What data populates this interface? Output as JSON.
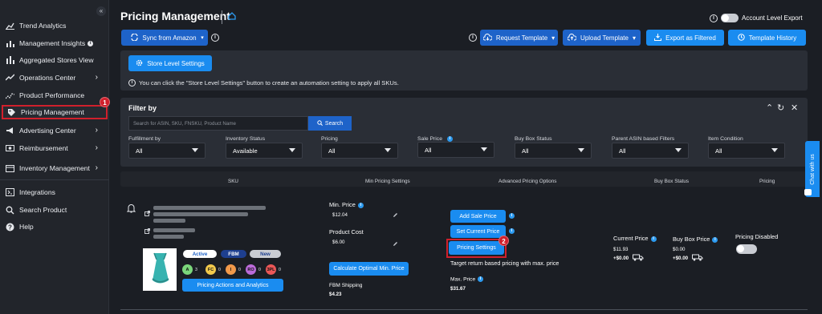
{
  "sidebar": {
    "items": [
      {
        "label": "Trend Analytics"
      },
      {
        "label": "Management Insights"
      },
      {
        "label": "Aggregated Stores View"
      },
      {
        "label": "Operations Center"
      },
      {
        "label": "Product Performance"
      },
      {
        "label": "Pricing Management"
      },
      {
        "label": "Advertising Center"
      },
      {
        "label": "Reimbursement"
      },
      {
        "label": "Inventory Management"
      },
      {
        "label": "Integrations"
      },
      {
        "label": "Search Product"
      },
      {
        "label": "Help"
      }
    ],
    "collapse_glyph": "«",
    "step_badge": "1"
  },
  "header": {
    "title": "Pricing Management",
    "sync_label": "Sync from Amazon",
    "request_template": "Request Template",
    "upload_template": "Upload Template",
    "export_label": "Export as Filtered",
    "template_history": "Template History",
    "account_level_export": "Account Level Export"
  },
  "store": {
    "button_label": "Store Level Settings",
    "hint": "You can click the \"Store Level Settings\" button to create an automation setting to apply all SKUs."
  },
  "filter": {
    "title": "Filter by",
    "search_placeholder": "Search for ASIN, SKU, FNSKU, Product Name",
    "search_button": "Search",
    "fields": [
      {
        "label": "Fulfillment by",
        "value": "All"
      },
      {
        "label": "Inventory Status",
        "value": "Available"
      },
      {
        "label": "Pricing",
        "value": "All"
      },
      {
        "label": "Sale Price",
        "value": "All"
      },
      {
        "label": "Buy Box Status",
        "value": "All"
      },
      {
        "label": "Parent ASIN based Filters",
        "value": "All"
      },
      {
        "label": "Item Condition",
        "value": "All"
      }
    ]
  },
  "table": {
    "headers": [
      "SKU",
      "Min Pricing Settings",
      "Advanced Pricing Options",
      "Buy Box Status",
      "Pricing"
    ],
    "row": {
      "pills": [
        "Active",
        "FBM",
        "New"
      ],
      "mini_badges": [
        {
          "label": "A",
          "count": "3",
          "color": "#7bd67b"
        },
        {
          "label": "FC",
          "count": "0",
          "color": "#f2c94c"
        },
        {
          "label": "I",
          "count": "0",
          "color": "#f2994a"
        },
        {
          "label": "RO",
          "count": "0",
          "color": "#bb6bd9"
        },
        {
          "label": "3PL",
          "count": "0",
          "color": "#eb5757"
        }
      ],
      "pricing_actions": "Pricing Actions and Analytics",
      "min_price_label": "Min. Price",
      "min_price_value": "$12.04",
      "product_cost_label": "Product Cost",
      "product_cost_value": "$6.00",
      "calc_button": "Calculate Optimal Min. Price",
      "fbm_shipping_label": "FBM Shipping",
      "fbm_shipping_value": "$4.23",
      "add_sale_price": "Add Sale Price",
      "set_current_price": "Set Current Price",
      "pricing_settings": "Pricing Settings",
      "step_badge": "2",
      "target_text": "Target return based pricing with max. price",
      "max_price_label": "Max. Price",
      "max_price_value": "$31.67",
      "current_price_label": "Current Price",
      "current_price_value": "$11.93",
      "current_price_shipping": "+$0.00",
      "buy_box_price_label": "Buy Box Price",
      "buy_box_price_value": "$0.00",
      "buy_box_shipping": "+$0.00",
      "pricing_disabled": "Pricing Disabled"
    }
  },
  "chat": {
    "label": "Chat with us"
  },
  "colors": {
    "accent": "#1a8cf0",
    "highlight": "#d0202c",
    "background": "#1b1e24"
  }
}
